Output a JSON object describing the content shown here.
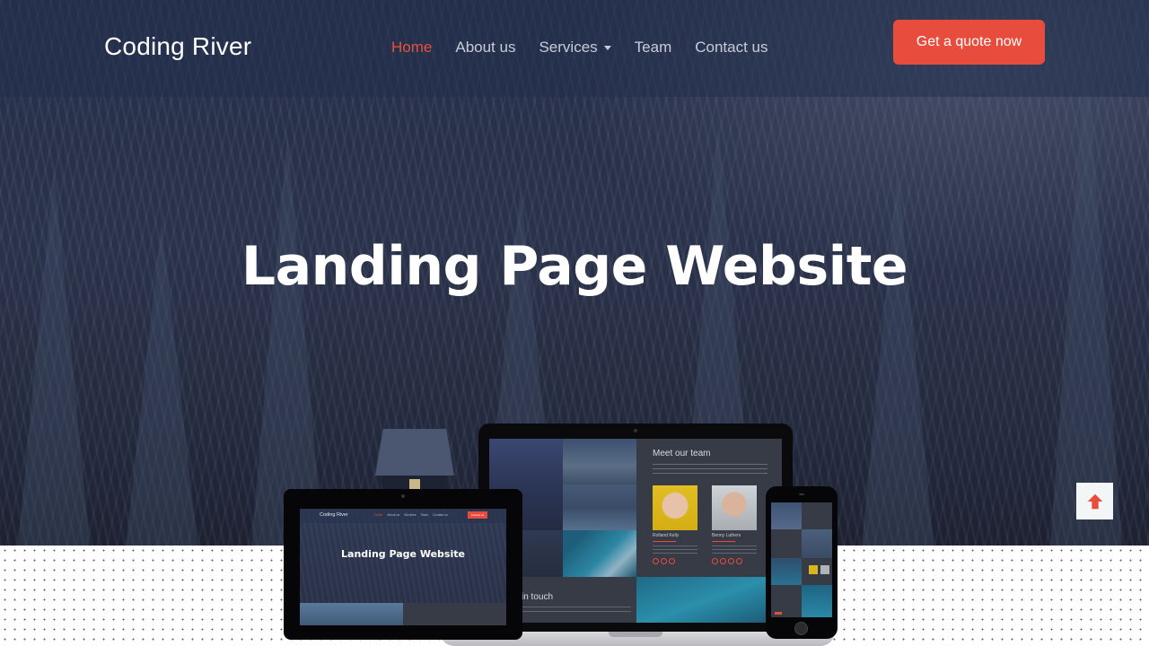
{
  "navbar": {
    "brand": "Coding River",
    "links": [
      {
        "label": "Home",
        "active": true
      },
      {
        "label": "About us",
        "active": false
      },
      {
        "label": "Services",
        "active": false,
        "has_dropdown": true
      },
      {
        "label": "Team",
        "active": false
      },
      {
        "label": "Contact us",
        "active": false
      }
    ],
    "cta_label": "Get a quote now"
  },
  "hero": {
    "title": "Landing Page Website"
  },
  "scroll_top": {
    "icon": "arrow-up-icon"
  },
  "mockups": {
    "laptop": {
      "team_title": "Meet our team",
      "members": [
        {
          "name": "Rolland Kelly"
        },
        {
          "name": "Benny Luthers"
        }
      ],
      "contact_title": "in touch"
    },
    "tablet": {
      "brand": "Coding River",
      "links": [
        "Home",
        "About us",
        "Services",
        "Team",
        "Contact us"
      ],
      "cta_label": "Contact us",
      "title": "Landing Page Website"
    }
  },
  "colors": {
    "accent": "#e84c3d",
    "nav_text": "#c8ccd6",
    "hero_overlay": "#2a3450"
  }
}
